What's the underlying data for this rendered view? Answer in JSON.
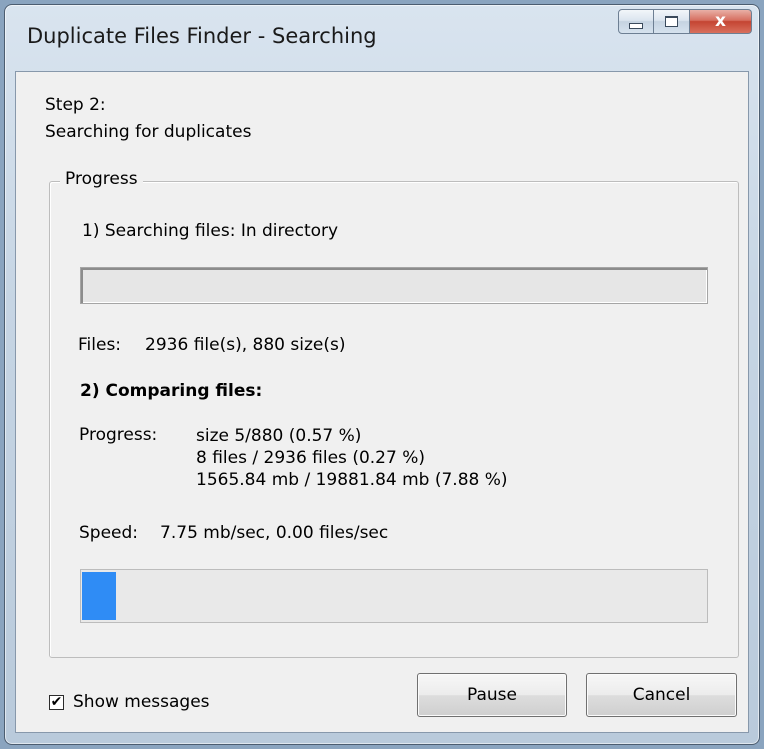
{
  "window": {
    "title": "Duplicate Files Finder - Searching",
    "controls": {
      "minimize_icon": "minimize-icon",
      "maximize_icon": "maximize-icon",
      "close_glyph": "x"
    }
  },
  "step": {
    "title": "Step 2:",
    "subtitle": "Searching for duplicates"
  },
  "progress_group": {
    "legend": "Progress",
    "search_label": "1) Searching files: In directory",
    "search_progress_percent": 0,
    "files_label": "Files:",
    "files_value": "2936 file(s), 880 size(s)",
    "compare_title": "2) Comparing files:",
    "progress_label": "Progress:",
    "progress_lines": [
      "size 5/880 (0.57 %)",
      "8 files / 2936 files (0.27 %)",
      "1565.84 mb / 19881.84 mb (7.88 %)"
    ],
    "speed_label": "Speed:",
    "speed_value": "7.75 mb/sec, 0.00 files/sec",
    "compare_progress_percent": 5.5,
    "compare_fill_color": "#2f8cf5"
  },
  "footer": {
    "show_messages_label": "Show messages",
    "show_messages_checked": true,
    "pause_label": "Pause",
    "cancel_label": "Cancel"
  }
}
